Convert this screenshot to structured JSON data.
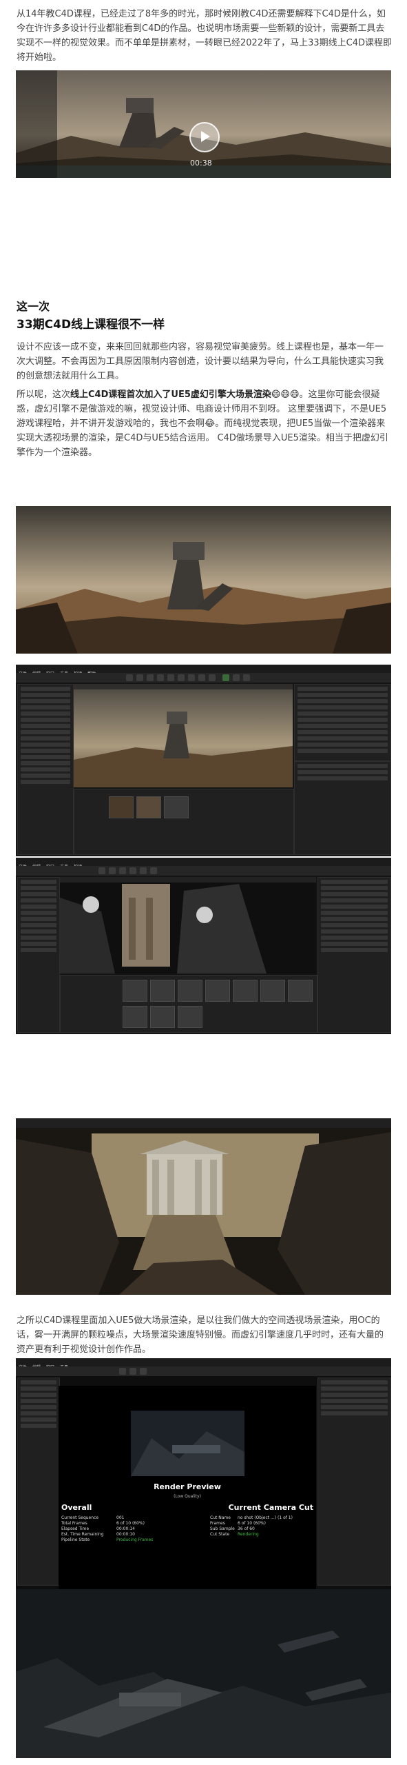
{
  "intro": {
    "text": "从14年教C4D课程，已经走过了8年多的时光，那时候刚教C4D还需要解释下C4D是什么，如今在许许多多设计行业都能看到C4D的作品。也说明市场需要一些新颖的设计，需要新工具去实现不一样的视觉效果。而不单单是拼素材，一转眼已经2022年了，马上33期线上C4D课程即将开始啦。"
  },
  "video": {
    "time": "00:38"
  },
  "section": {
    "heading_line1": "这一次",
    "heading_line2": "33期C4D线上课程很不一样"
  },
  "para2": {
    "text": "设计不应该一成不变，来来回回就那些内容，容易视觉审美疲劳。线上课程也是，基本一年一次大调整。不会再因为工具原因限制内容创造，设计要以结果为导向，什么工具能快速实习我的创意想法就用什么工具。"
  },
  "para3": {
    "prefix": "所以呢，这次",
    "bold": "线上C4D课程首次加入了UE5虚幻引擎大场景渲染😄😄😄",
    "rest": "。这里你可能会很疑惑，虚幻引擎不是做游戏的嘛，视觉设计师、电商设计师用不到呀。 这里要强调下，不是UE5游戏课程哈，并不讲开发游戏哈的，我也不会啊😂。而纯视觉表现，把UE5当做一个渲染器来实现大透视场景的渲染，是C4D与UE5结合运用。 C4D做场景导入UE5渲染。相当于把虚幻引擎作为一个渲染器。"
  },
  "para4": {
    "text": "之所以C4D课程里面加入UE5做大场景渲染，是以往我们做大的空间透视场景渲染，用OC的话，雾一开满屏的颗粒噪点，大场景渲染速度特别慢。而虚幻引擎速度几乎时时，还有大量的资产更有利于视觉设计创作作品。"
  },
  "render_preview": {
    "title": "Render Preview",
    "subtitle": "(Low Quality)",
    "overall_label": "Overall",
    "camera_label": "Current Camera Cut",
    "left_rows": [
      [
        "Current Sequence",
        "001"
      ],
      [
        "Total Frames",
        "6 of 10 (60%)"
      ],
      [
        "Elapsed Time",
        "00:00:14"
      ],
      [
        "Est. Time Remaining",
        "00:00:10"
      ],
      [
        "Pipeline State",
        "Producing Frames"
      ]
    ],
    "right_rows": [
      [
        "Cut Name",
        "no shot (Object ...) (1 of 1)"
      ],
      [
        "Frames",
        "6 of 10 (60%)"
      ],
      [
        "Sub Sample",
        "36 of 60"
      ],
      [
        "Cut State",
        "Rendering"
      ]
    ]
  },
  "colors": {
    "status_green": "#3fbf3f",
    "ue_dark": "#151515"
  }
}
